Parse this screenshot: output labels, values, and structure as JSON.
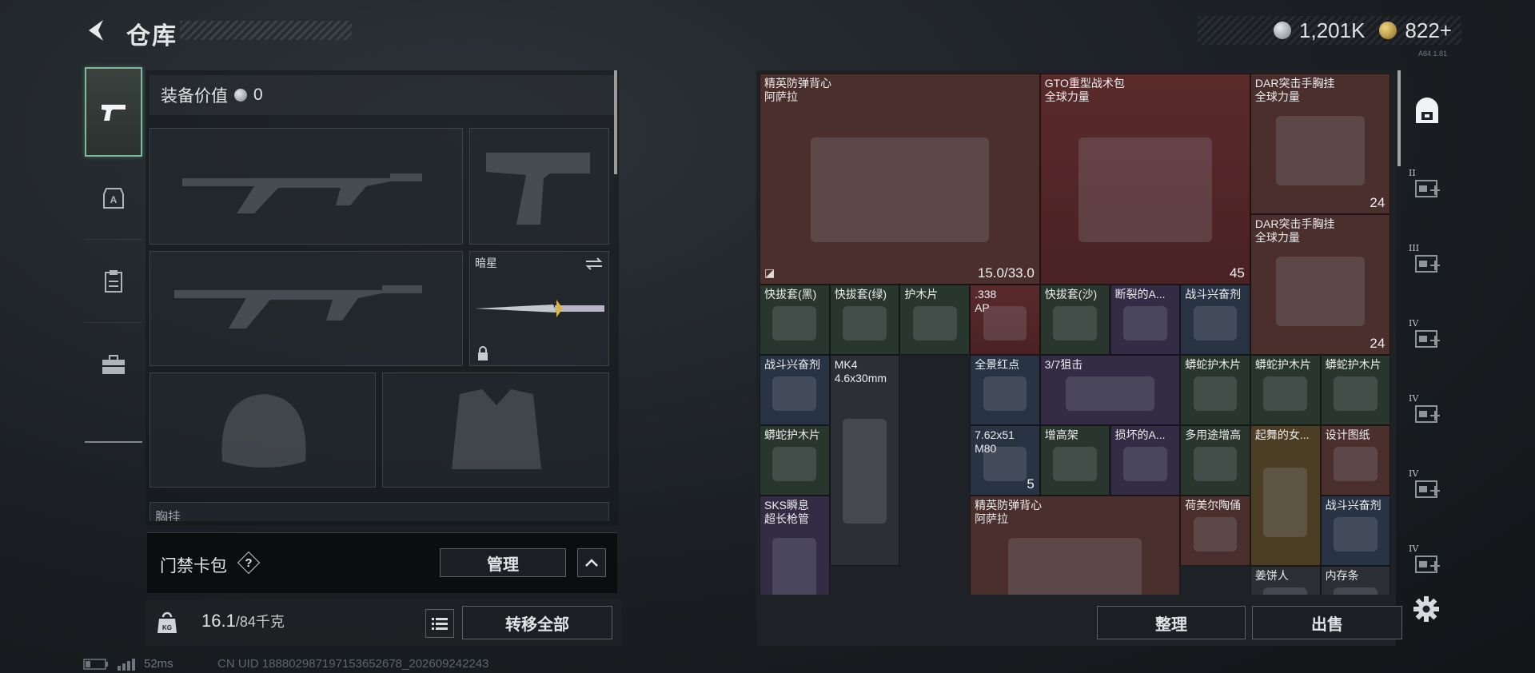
{
  "header": {
    "back_icon": "back-arrow-icon",
    "title": "仓库",
    "currency": [
      {
        "icon": "silver-coin-icon",
        "value": "1,201K"
      },
      {
        "icon": "gold-coin-icon",
        "value": "822+"
      }
    ],
    "version_text": "A84 1.81"
  },
  "left_sidebar": {
    "items": [
      {
        "name": "weapons",
        "icon": "pistol-icon",
        "active": true
      },
      {
        "name": "armor",
        "icon": "armor-badge-icon",
        "active": false
      },
      {
        "name": "consumables",
        "icon": "clipboard-icon",
        "active": false
      },
      {
        "name": "tools",
        "icon": "toolbox-icon",
        "active": false
      }
    ]
  },
  "equipment": {
    "value_label": "装备价值",
    "value": "0",
    "melee_slot": {
      "name": "暗星",
      "swap_icon": "swap-arrows-icon",
      "lock_icon": "lock-icon"
    },
    "chest_rig_label": "胸挂"
  },
  "keycard": {
    "label": "门禁卡包",
    "help": "?",
    "manage_label": "管理",
    "collapse_icon": "chevron-up-icon"
  },
  "weight": {
    "current": "16.1",
    "max": "/84千克",
    "list_icon": "list-icon",
    "transfer_label": "转移全部"
  },
  "status": {
    "battery_icon": "battery-icon",
    "signal_icon": "signal-icon",
    "ping": "52ms",
    "uid": "CN UID 18880298719715365​2678_202609242243"
  },
  "storage": {
    "items": [
      {
        "name": "精英防弹背心\n阿萨拉",
        "badge": "15.0/33.0",
        "rarity": "red",
        "corner": "◪"
      },
      {
        "name": "GTO重型战术包\n全球力量",
        "badge": "45",
        "rarity": "redb"
      },
      {
        "name": "DAR突击手胸挂\n全球力量",
        "badge": "24",
        "rarity": "red"
      },
      {
        "name": "DAR突击手胸挂\n全球力量",
        "badge": "24",
        "rarity": "red"
      },
      {
        "name": "快拔套(黑)",
        "rarity": "green"
      },
      {
        "name": "快拔套(绿)",
        "rarity": "green"
      },
      {
        "name": "护木片",
        "rarity": "green"
      },
      {
        "name": ".338\nAP",
        "rarity": "redb"
      },
      {
        "name": "快拔套(沙)",
        "rarity": "green"
      },
      {
        "name": "断裂的A...",
        "rarity": "purple"
      },
      {
        "name": "战斗兴奋剂",
        "rarity": "blue"
      },
      {
        "name": "战斗兴奋剂",
        "rarity": "blue"
      },
      {
        "name": "MK4\n4.6x30mm",
        "rarity": "gray"
      },
      {
        "name": "全景红点",
        "rarity": "blue"
      },
      {
        "name": "3/7狙击",
        "rarity": "purple"
      },
      {
        "name": "蟒蛇护木片",
        "rarity": "green"
      },
      {
        "name": "蟒蛇护木片",
        "rarity": "green"
      },
      {
        "name": "蟒蛇护木片",
        "rarity": "green"
      },
      {
        "name": "蟒蛇护木片",
        "rarity": "green"
      },
      {
        "name": "7.62x51\nM80",
        "badge": "5",
        "rarity": "blue"
      },
      {
        "name": "增高架",
        "rarity": "green"
      },
      {
        "name": "损坏的A...",
        "rarity": "purple"
      },
      {
        "name": "多用途增高",
        "rarity": "green"
      },
      {
        "name": "起舞的女...",
        "rarity": "gold"
      },
      {
        "name": "设计图纸",
        "rarity": "red"
      },
      {
        "name": "SKS瞬息\n超长枪管",
        "rarity": "purple"
      },
      {
        "name": "精英防弹背心\n阿萨拉",
        "rarity": "red"
      },
      {
        "name": "荷美尔陶俑",
        "rarity": "red"
      },
      {
        "name": "战斗兴奋剂",
        "rarity": "blue"
      },
      {
        "name": "姜饼人",
        "rarity": "gray"
      },
      {
        "name": "内存条",
        "rarity": "gray"
      }
    ],
    "sort_label": "整理",
    "sell_label": "出售"
  },
  "storage_sidebar": {
    "items": [
      {
        "roman": "",
        "icon": "safe-box-icon"
      },
      {
        "roman": "II",
        "icon": "stash-expansion-icon"
      },
      {
        "roman": "III",
        "icon": "stash-expansion-icon"
      },
      {
        "roman": "IV",
        "icon": "folder-expansion-icon"
      },
      {
        "roman": "IV",
        "icon": "medical-expansion-icon"
      },
      {
        "roman": "IV",
        "icon": "ammo-expansion-icon"
      },
      {
        "roman": "IV",
        "icon": "stash-expansion-icon"
      }
    ],
    "settings_icon": "gear-icon"
  }
}
